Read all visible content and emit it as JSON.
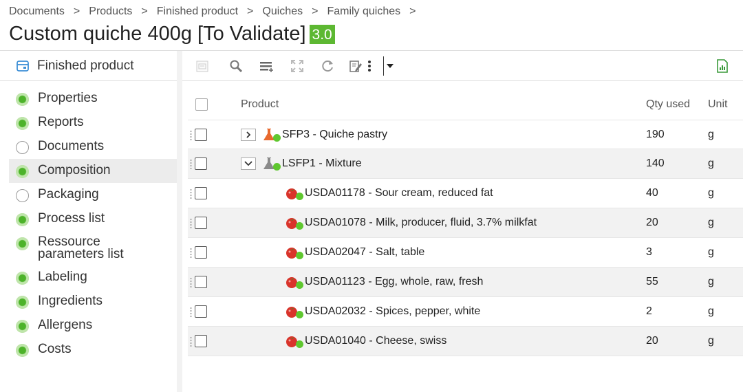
{
  "breadcrumb": [
    "Documents",
    "Products",
    "Finished product",
    "Quiches",
    "Family quiches"
  ],
  "breadcrumb_separator": ">",
  "title": "Custom quiche 400g [To Validate]",
  "version": "3.0",
  "sidebar": {
    "header": "Finished product",
    "items": [
      {
        "label": "Properties",
        "status": "filled"
      },
      {
        "label": "Reports",
        "status": "filled"
      },
      {
        "label": "Documents",
        "status": "empty"
      },
      {
        "label": "Composition",
        "status": "filled",
        "active": true
      },
      {
        "label": "Packaging",
        "status": "empty"
      },
      {
        "label": "Process list",
        "status": "filled"
      },
      {
        "label": "Ressource parameters list",
        "status": "filled"
      },
      {
        "label": "Labeling",
        "status": "filled"
      },
      {
        "label": "Ingredients",
        "status": "filled"
      },
      {
        "label": "Allergens",
        "status": "filled"
      },
      {
        "label": "Costs",
        "status": "filled"
      }
    ]
  },
  "toolbar": {
    "icons": [
      "import-icon",
      "search-icon",
      "add-list-icon",
      "fullscreen-icon",
      "refresh-icon",
      "edit-icon",
      "more-icon",
      "dropdown-icon",
      "export-excel-icon"
    ]
  },
  "table": {
    "columns": {
      "product": "Product",
      "qty": "Qty used",
      "unit": "Unit"
    },
    "rows": [
      {
        "product": "SFP3 - Quiche pastry",
        "qty": "190",
        "unit": "g",
        "kind": "semi-finished",
        "expander": "collapsed",
        "level": 0
      },
      {
        "product": "LSFP1 - Mixture",
        "qty": "140",
        "unit": "g",
        "kind": "local-semi-finished",
        "expander": "expanded",
        "level": 0
      },
      {
        "product": "USDA01178 - Sour cream, reduced fat",
        "qty": "40",
        "unit": "g",
        "kind": "raw-material",
        "level": 1
      },
      {
        "product": "USDA01078 - Milk, producer, fluid, 3.7% milkfat",
        "qty": "20",
        "unit": "g",
        "kind": "raw-material",
        "level": 1
      },
      {
        "product": "USDA02047 - Salt, table",
        "qty": "3",
        "unit": "g",
        "kind": "raw-material",
        "level": 1
      },
      {
        "product": "USDA01123 - Egg, whole, raw, fresh",
        "qty": "55",
        "unit": "g",
        "kind": "raw-material",
        "level": 1
      },
      {
        "product": "USDA02032 - Spices, pepper, white",
        "qty": "2",
        "unit": "g",
        "kind": "raw-material",
        "level": 1
      },
      {
        "product": "USDA01040 - Cheese, swiss",
        "qty": "20",
        "unit": "g",
        "kind": "raw-material",
        "level": 1
      }
    ]
  },
  "colors": {
    "accent_green": "#5db832",
    "status_green": "#5fc72f",
    "flask_orange": "#e8692e",
    "flask_grey": "#8a8a8a",
    "tomato_red": "#d9342b"
  }
}
